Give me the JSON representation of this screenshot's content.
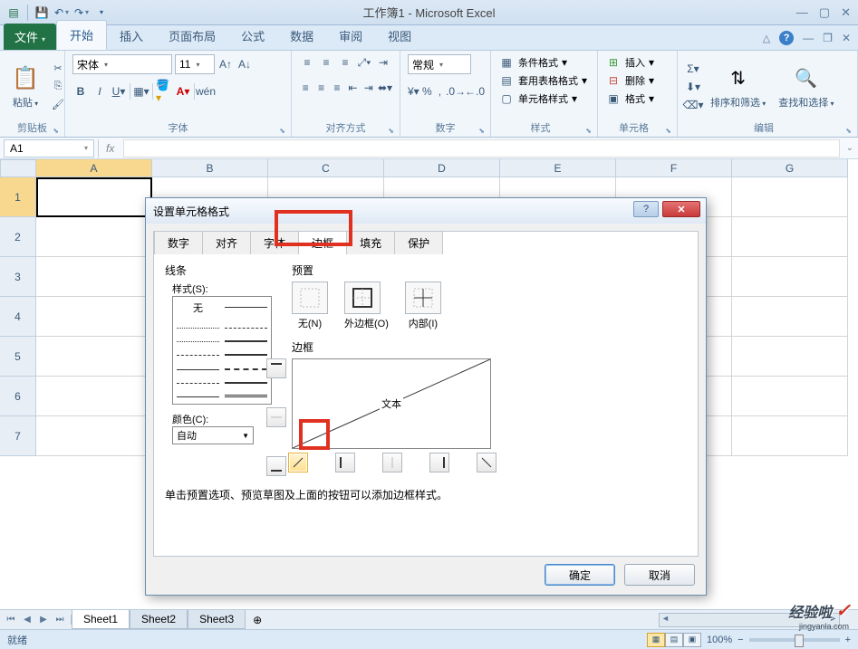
{
  "window": {
    "title": "工作簿1 - Microsoft Excel"
  },
  "ribbon_tabs": {
    "file": "文件",
    "items": [
      "开始",
      "插入",
      "页面布局",
      "公式",
      "数据",
      "审阅",
      "视图"
    ],
    "active": "开始"
  },
  "ribbon_groups": {
    "clipboard": {
      "label": "剪贴板",
      "paste": "粘贴"
    },
    "font": {
      "label": "字体",
      "name": "宋体",
      "size": "11"
    },
    "alignment": {
      "label": "对齐方式"
    },
    "number": {
      "label": "数字",
      "format": "常规"
    },
    "styles": {
      "label": "样式",
      "conditional": "条件格式",
      "table": "套用表格格式",
      "cell": "单元格样式"
    },
    "cells": {
      "label": "单元格",
      "insert": "插入",
      "delete": "删除",
      "format": "格式"
    },
    "editing": {
      "label": "编辑",
      "sort": "排序和筛选",
      "find": "查找和选择"
    }
  },
  "name_box": "A1",
  "columns": [
    "A",
    "B",
    "C",
    "D",
    "E",
    "F",
    "G"
  ],
  "rows": [
    "1",
    "2",
    "3",
    "4",
    "5",
    "6",
    "7"
  ],
  "dialog": {
    "title": "设置单元格格式",
    "tabs": [
      "数字",
      "对齐",
      "字体",
      "边框",
      "填充",
      "保护"
    ],
    "active_tab": "边框",
    "line_section": "线条",
    "style_label": "样式(S):",
    "style_none": "无",
    "color_label": "颜色(C):",
    "color_value": "自动",
    "preset_label": "预置",
    "preset_none": "无(N)",
    "preset_outline": "外边框(O)",
    "preset_inside": "内部(I)",
    "border_label": "边框",
    "preview_text": "文本",
    "hint": "单击预置选项、预览草图及上面的按钮可以添加边框样式。",
    "ok": "确定",
    "cancel": "取消"
  },
  "sheets": [
    "Sheet1",
    "Sheet2",
    "Sheet3"
  ],
  "status": {
    "ready": "就绪",
    "zoom": "100%"
  },
  "watermark": "经验啦",
  "watermark_sub": "jingyanla.com"
}
